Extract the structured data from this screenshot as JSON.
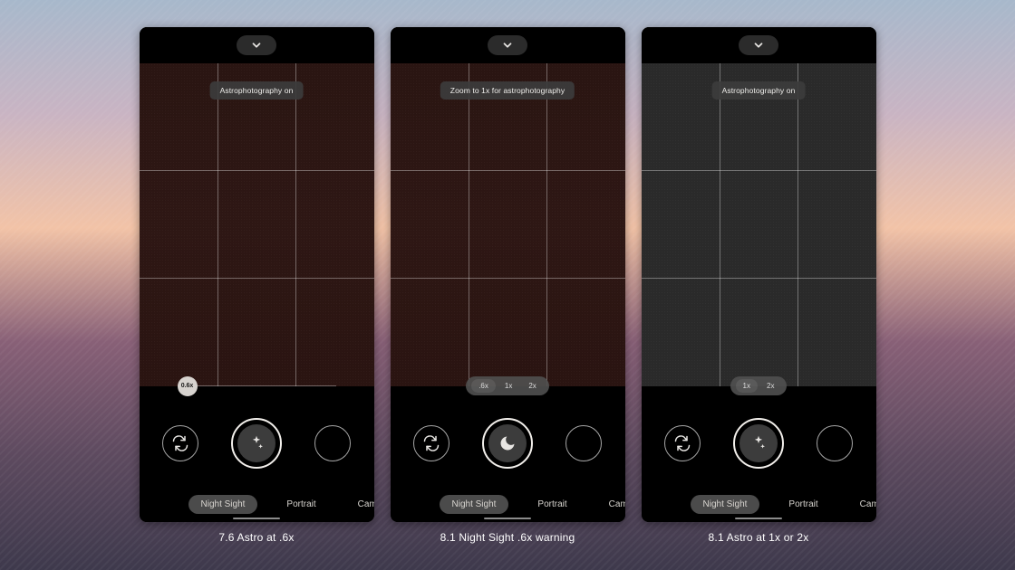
{
  "screens": [
    {
      "caption": "7.6 Astro at .6x",
      "viewfinder_style": "reddish",
      "toast": "Astrophotography on",
      "zoom_ui": "slider",
      "zoom_slider_label": "0.6x",
      "zoom_options": [],
      "shutter_icon": "stars",
      "modes": {
        "active": "Night Sight",
        "items": [
          "Night Sight",
          "Portrait",
          "Came"
        ]
      }
    },
    {
      "caption": "8.1 Night Sight .6x warning",
      "viewfinder_style": "reddish",
      "toast": "Zoom to 1x for astrophotography",
      "zoom_ui": "pill",
      "zoom_slider_label": "",
      "zoom_options": [
        ".6x",
        "1x",
        "2x"
      ],
      "shutter_icon": "moon",
      "modes": {
        "active": "Night Sight",
        "items": [
          "Night Sight",
          "Portrait",
          "Came"
        ]
      }
    },
    {
      "caption": "8.1 Astro at 1x or 2x",
      "viewfinder_style": "dark",
      "toast": "Astrophotography on",
      "zoom_ui": "pill",
      "zoom_slider_label": "",
      "zoom_options": [
        "1x",
        "2x"
      ],
      "shutter_icon": "stars",
      "modes": {
        "active": "Night Sight",
        "items": [
          "Night Sight",
          "Portrait",
          "Came"
        ]
      }
    }
  ]
}
